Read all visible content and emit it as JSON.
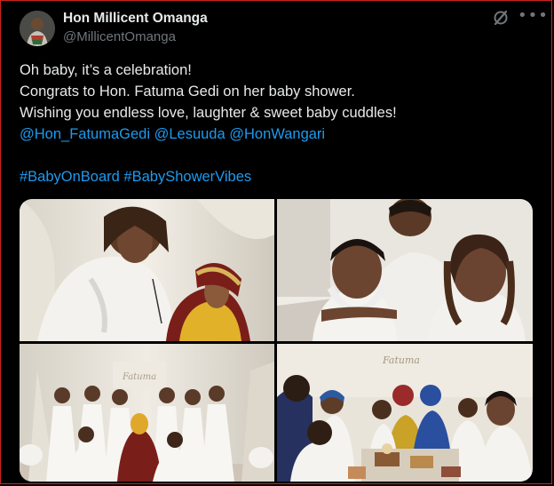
{
  "tweet": {
    "author_name": "Hon Millicent Omanga",
    "author_handle": "@MillicentOmanga",
    "lines": [
      "Oh baby, it’s a celebration!",
      "Congrats to Hon. Fatuma Gedi on her baby shower.",
      "Wishing you endless love, laughter & sweet baby cuddles!"
    ],
    "mentions": [
      "@Hon_FatumaGedi",
      "@Lesuuda",
      "@HonWangari"
    ],
    "hashtags": [
      "#BabyOnBoard",
      "#BabyShowerVibes"
    ]
  },
  "media": {
    "photo_texts": [
      "Fatuma",
      "Fatuma"
    ]
  },
  "icons": {
    "grok": "grok-icon",
    "more": "more-options-icon"
  },
  "colors": {
    "background": "#000000",
    "text": "#e7e9ea",
    "secondary": "#71767b",
    "link": "#1d9bf0",
    "border": "#d0231f"
  }
}
